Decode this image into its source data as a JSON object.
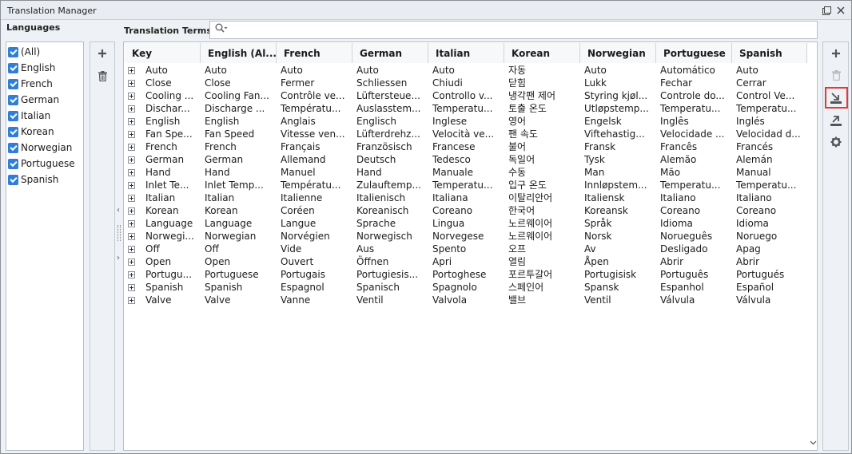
{
  "window": {
    "title": "Translation Manager",
    "restore_icon": "restore-window-icon",
    "close_icon": "close-icon"
  },
  "languages": {
    "header": "Languages",
    "items": [
      {
        "label": "(All)",
        "checked": true
      },
      {
        "label": "English",
        "checked": true
      },
      {
        "label": "French",
        "checked": true
      },
      {
        "label": "German",
        "checked": true
      },
      {
        "label": "Italian",
        "checked": true
      },
      {
        "label": "Korean",
        "checked": true
      },
      {
        "label": "Norwegian",
        "checked": true
      },
      {
        "label": "Portuguese",
        "checked": true
      },
      {
        "label": "Spanish",
        "checked": true
      }
    ]
  },
  "terms": {
    "label": "Translation Terms",
    "search_value": "",
    "search_icon": "search-dropdown-icon",
    "columns": [
      "Key",
      "English (Al...",
      "French",
      "German",
      "Italian",
      "Korean",
      "Norwegian",
      "Portuguese",
      "Spanish"
    ],
    "rows": [
      [
        "Auto",
        "Auto",
        "Auto",
        "Auto",
        "Auto",
        "자동",
        "Auto",
        "Automático",
        "Auto"
      ],
      [
        "Close",
        "Close",
        "Fermer",
        "Schliessen",
        "Chiudi",
        "닫힘",
        "Lukk",
        "Fechar",
        "Cerrar"
      ],
      [
        "Cooling ...",
        "Cooling Fan...",
        "Contrôle ve...",
        "Lüftersteue...",
        "Controllo v...",
        "냉각팬 제어",
        "Styring kjøl...",
        "Controle do...",
        "Control Ve..."
      ],
      [
        "Dischar...",
        "Discharge ...",
        "Températu...",
        "Auslasstem...",
        "Temperatu...",
        "토출 온도",
        "Utløpstemp...",
        "Temperatu...",
        "Temperatu..."
      ],
      [
        "English",
        "English",
        "Anglais",
        "Englisch",
        "Inglese",
        "영어",
        "Engelsk",
        "Inglês",
        "Inglés"
      ],
      [
        "Fan Spe...",
        "Fan Speed",
        "Vitesse ven...",
        "Lüfterdrehz...",
        "Velocità ve...",
        "팬 속도",
        "Viftehastig...",
        "Velocidade ...",
        "Velocidad d..."
      ],
      [
        "French",
        "French",
        "Français",
        "Französisch",
        "Francese",
        "불어",
        "Fransk",
        "Francês",
        "Francés"
      ],
      [
        "German",
        "German",
        "Allemand",
        "Deutsch",
        "Tedesco",
        "독일어",
        "Tysk",
        "Alemão",
        "Alemán"
      ],
      [
        "Hand",
        "Hand",
        "Manuel",
        "Hand",
        "Manuale",
        "수동",
        "Man",
        "Mão",
        "Manual"
      ],
      [
        "Inlet Te...",
        "Inlet Temp...",
        "Températu...",
        "Zulauftemp...",
        "Temperatu...",
        "입구 온도",
        "Innløpstem...",
        "Temperatu...",
        "Temperatu..."
      ],
      [
        "Italian",
        "Italian",
        "Italienne",
        "Italienisch",
        "Italiana",
        "이탈리안어",
        "Italiensk",
        "Italiano",
        "Italiano"
      ],
      [
        "Korean",
        "Korean",
        "Coréen",
        "Koreanisch",
        "Coreano",
        "한국어",
        "Koreansk",
        "Coreano",
        "Coreano"
      ],
      [
        "Language",
        "Language",
        "Langue",
        "Sprache",
        "Lingua",
        "노르웨이어",
        "Språk",
        "Idioma",
        "Idioma"
      ],
      [
        "Norwegi...",
        "Norwegian",
        "Norvégien",
        "Norwegisch",
        "Norvegese",
        "노르웨이어",
        "Norsk",
        "Norueguês",
        "Noruego"
      ],
      [
        "Off",
        "Off",
        "Vide",
        "Aus",
        "Spento",
        "오프",
        "Av",
        "Desligado",
        "Apag"
      ],
      [
        "Open",
        "Open",
        "Ouvert",
        "Öffnen",
        "Apri",
        "열림",
        "Åpen",
        "Abrir",
        "Abrir"
      ],
      [
        "Portugu...",
        "Portuguese",
        "Portugais",
        "Portugiesis...",
        "Portoghese",
        "포르투갈어",
        "Portugisisk",
        "Português",
        "Portugués"
      ],
      [
        "Spanish",
        "Spanish",
        "Espagnol",
        "Spanisch",
        "Spagnolo",
        "스페인어",
        "Spansk",
        "Espanhol",
        "Español"
      ],
      [
        "Valve",
        "Valve",
        "Vanne",
        "Ventil",
        "Valvola",
        "밸브",
        "Ventil",
        "Válvula",
        "Válvula"
      ]
    ]
  },
  "toolbar_left": {
    "add_icon": "add-icon",
    "delete_icon": "trash-icon"
  },
  "toolbar_right": {
    "add_icon": "add-icon",
    "delete_icon": "trash-icon",
    "import_icon": "import-icon",
    "export_icon": "export-icon",
    "settings_icon": "gear-icon",
    "highlighted": "import"
  },
  "colors": {
    "accent": "#2f7fd6",
    "highlight": "#e53935"
  }
}
